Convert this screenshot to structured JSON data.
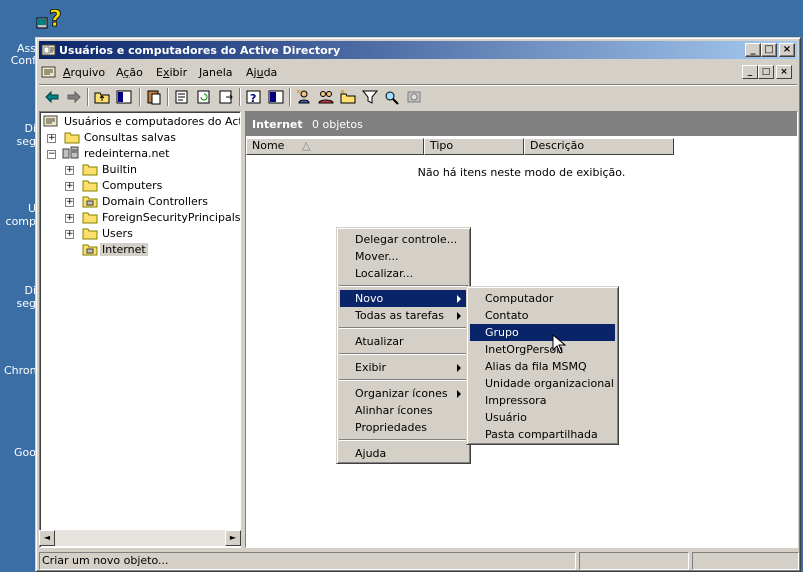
{
  "desktop": {
    "labels": [
      "Ass",
      "Conf",
      "Di",
      "seg",
      "U",
      "comp",
      "Di",
      "seg",
      "Chron",
      "Goo"
    ]
  },
  "window": {
    "title": "Usuários e computadores do Active Directory",
    "caption_buttons": {
      "minimize": "_",
      "maximize": "□",
      "close": "×"
    }
  },
  "menubar": {
    "items": [
      {
        "label": "Arquivo",
        "key": "A",
        "rest": "rquivo"
      },
      {
        "label": "Ação",
        "key": "ç",
        "pre": "A",
        "rest": "ão"
      },
      {
        "label": "Exibir",
        "key": "x",
        "pre": "E",
        "rest": "ibir"
      },
      {
        "label": "Janela",
        "key": "J",
        "rest": "anela"
      },
      {
        "label": "Ajuda",
        "key": "u",
        "pre": "Aj",
        "rest": "da"
      }
    ]
  },
  "tree": {
    "root": "Usuários e computadores do Active D",
    "saved_queries": "Consultas salvas",
    "domain": "redeinterna.net",
    "children": [
      "Builtin",
      "Computers",
      "Domain Controllers",
      "ForeignSecurityPrincipals",
      "Users",
      "Internet"
    ],
    "expanders": {
      "collapsed": "+",
      "expanded": "−"
    }
  },
  "details": {
    "title": "Internet",
    "count": "0 objetos",
    "columns": [
      "Nome",
      "Tipo",
      "Descrição"
    ],
    "sort_indicator": "△",
    "empty_message": "Não há itens neste modo de exibição."
  },
  "context_menu": {
    "items": [
      "Delegar controle...",
      "Mover...",
      "Localizar...",
      "Novo",
      "Todas as tarefas",
      "Atualizar",
      "Exibir",
      "Organizar ícones",
      "Alinhar ícones",
      "Propriedades",
      "Ajuda"
    ]
  },
  "submenu_new": {
    "items": [
      "Computador",
      "Contato",
      "Grupo",
      "InetOrgPerson",
      "Alias da fila MSMQ",
      "Unidade organizacional",
      "Impressora",
      "Usuário",
      "Pasta compartilhada"
    ],
    "selected": "Grupo"
  },
  "statusbar": {
    "text": "Criar um novo objeto..."
  },
  "scroll": {
    "left": "◄",
    "right": "►"
  },
  "colors": {
    "desktop": "#3a6ea5",
    "title_active": "#0a246a",
    "face": "#d4d0c8",
    "selection": "#0a246a"
  }
}
